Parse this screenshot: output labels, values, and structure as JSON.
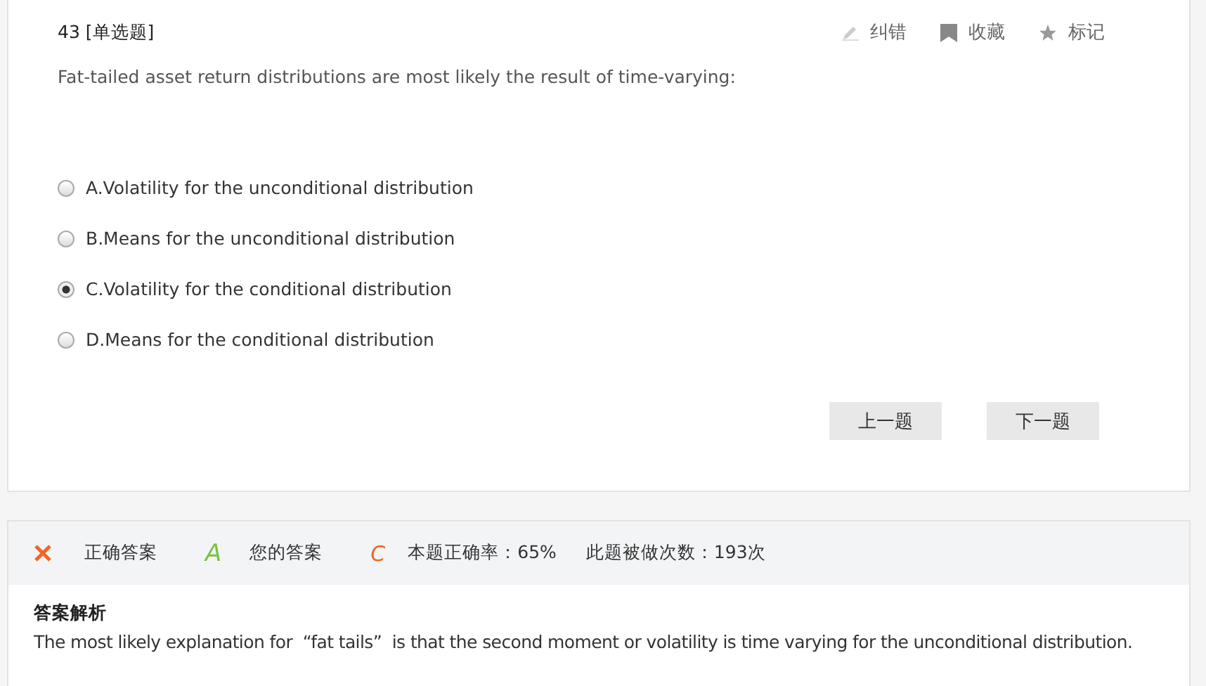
{
  "question": {
    "number": "43",
    "type": "[单选题]",
    "text": "Fat-tailed asset return distributions are most likely the result of time-varying:"
  },
  "actions": [
    {
      "kind": "edit",
      "label": "纠错"
    },
    {
      "kind": "bookmark",
      "label": "收藏"
    },
    {
      "kind": "star",
      "label": "标记"
    }
  ],
  "options": [
    {
      "label": "A.Volatility for the unconditional distribution",
      "selected": false
    },
    {
      "label": "B.Means for the unconditional distribution",
      "selected": false
    },
    {
      "label": "C.Volatility for the conditional distribution",
      "selected": true
    },
    {
      "label": "D.Means for the conditional distribution",
      "selected": false
    }
  ],
  "nav_buttons": [
    "上一题",
    "下一题"
  ],
  "result": {
    "correct": false,
    "correct_label": "正确答案",
    "correct_answer": "A",
    "your_label": "您的答案",
    "your_answer": "C",
    "accuracy": "本题正确率：65%",
    "attempts": "此题被做次数：193次"
  },
  "analysis": {
    "title": "答案解析",
    "text": "The most likely explanation for  “fat tails”  is that the second moment or volatility is time varying for the unconditional distribution."
  }
}
